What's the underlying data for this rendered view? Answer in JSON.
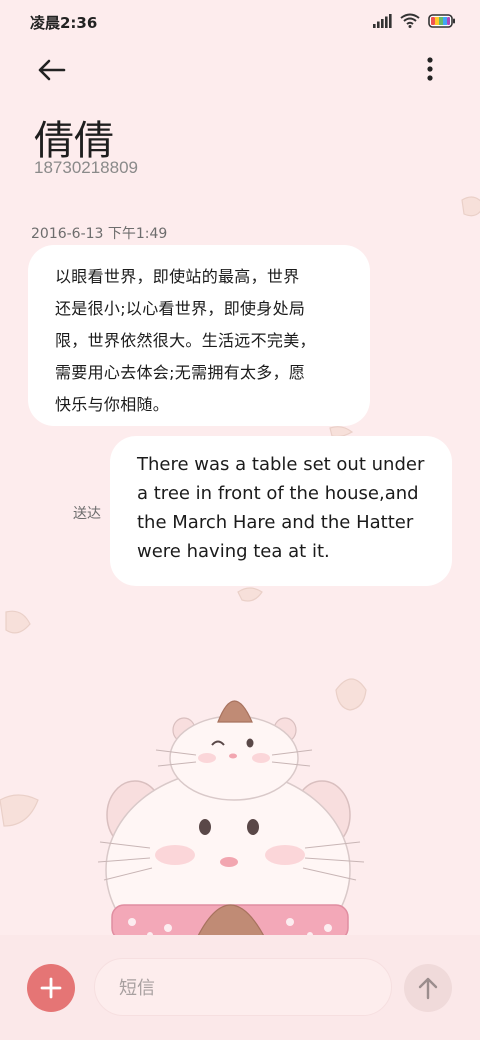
{
  "status_bar": {
    "time": "凌晨2:36",
    "icons": [
      "signal-icon",
      "wifi-icon",
      "battery-icon"
    ]
  },
  "header": {
    "back_icon": "arrow-left-icon",
    "more_icon": "vertical-dots-icon",
    "contact_name": "倩倩",
    "contact_number": "18730218809"
  },
  "conversation": {
    "timestamp": "2016-6-13 下午1:49",
    "incoming_lines": [
      "以眼看世界，即使站的最高，世界",
      "还是很小;以心看世界，即使身处局",
      "限，世界依然很大。生活远不完美，",
      "需要用心去体会;无需拥有太多，愿",
      "快乐与你相随。"
    ],
    "outgoing_lines": [
      "There was a table set out under",
      "a tree in front of the house,and",
      "the March Hare and the Hatter",
      "were having tea at it."
    ],
    "outgoing_status": "送达"
  },
  "composer": {
    "add_icon": "plus-icon",
    "placeholder": "短信",
    "send_icon": "arrow-up-icon"
  },
  "colors": {
    "background": "#fdeced",
    "bubble": "#ffffff",
    "add_button": "#e57575",
    "send_button": "#f0dada"
  }
}
